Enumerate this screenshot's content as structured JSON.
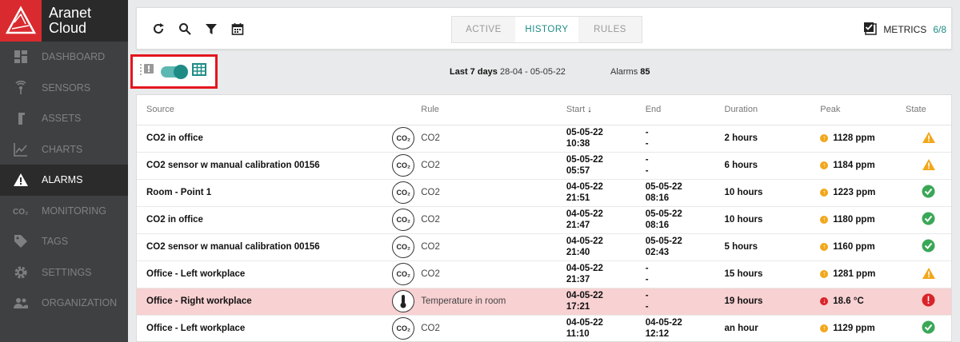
{
  "sidebar": {
    "brand_line1": "Aranet",
    "brand_line2": "Cloud",
    "items": [
      {
        "label": "DASHBOARD",
        "icon": "dashboard-icon",
        "active": false
      },
      {
        "label": "SENSORS",
        "icon": "sensors-icon",
        "active": false
      },
      {
        "label": "ASSETS",
        "icon": "assets-icon",
        "active": false
      },
      {
        "label": "CHARTS",
        "icon": "charts-icon",
        "active": false
      },
      {
        "label": "ALARMS",
        "icon": "alarm-icon",
        "active": true
      },
      {
        "label": "MONITORING",
        "icon": "co2-icon",
        "active": false
      },
      {
        "label": "TAGS",
        "icon": "tag-icon",
        "active": false
      },
      {
        "label": "SETTINGS",
        "icon": "gear-icon",
        "active": false
      },
      {
        "label": "ORGANIZATION",
        "icon": "people-icon",
        "active": false
      }
    ]
  },
  "topbar": {
    "tabs": [
      {
        "label": "ACTIVE",
        "active": false
      },
      {
        "label": "HISTORY",
        "active": true
      },
      {
        "label": "RULES",
        "active": false
      }
    ],
    "metrics_label": "METRICS",
    "metrics_count": "6/8"
  },
  "toolbar": {
    "range_label": "Last 7 days",
    "range_dates": "28-04 - 05-05-22",
    "alarms_label": "Alarms",
    "alarms_count": "85"
  },
  "table": {
    "columns": [
      "Source",
      "Rule",
      "Start",
      "End",
      "Duration",
      "Peak",
      "State"
    ],
    "rows": [
      {
        "source": "CO2 in office",
        "badge": "CO₂",
        "rule": "CO2",
        "start_date": "05-05-22",
        "start_time": "10:38",
        "end_date": "-",
        "end_time": "-",
        "duration": "2 hours",
        "peak": "1128 ppm",
        "peak_dir": "up",
        "state": "warning",
        "alert": false
      },
      {
        "source": "CO2 sensor w manual calibration 00156",
        "badge": "CO₂",
        "rule": "CO2",
        "start_date": "05-05-22",
        "start_time": "05:57",
        "end_date": "-",
        "end_time": "-",
        "duration": "6 hours",
        "peak": "1184 ppm",
        "peak_dir": "up",
        "state": "warning",
        "alert": false
      },
      {
        "source": "Room - Point 1",
        "badge": "CO₂",
        "rule": "CO2",
        "start_date": "04-05-22",
        "start_time": "21:51",
        "end_date": "05-05-22",
        "end_time": "08:16",
        "duration": "10 hours",
        "peak": "1223 ppm",
        "peak_dir": "up",
        "state": "ok",
        "alert": false
      },
      {
        "source": "CO2 in office",
        "badge": "CO₂",
        "rule": "CO2",
        "start_date": "04-05-22",
        "start_time": "21:47",
        "end_date": "05-05-22",
        "end_time": "08:16",
        "duration": "10 hours",
        "peak": "1180 ppm",
        "peak_dir": "up",
        "state": "ok",
        "alert": false
      },
      {
        "source": "CO2 sensor w manual calibration 00156",
        "badge": "CO₂",
        "rule": "CO2",
        "start_date": "04-05-22",
        "start_time": "21:40",
        "end_date": "05-05-22",
        "end_time": "02:43",
        "duration": "5 hours",
        "peak": "1160 ppm",
        "peak_dir": "up",
        "state": "ok",
        "alert": false
      },
      {
        "source": "Office - Left workplace",
        "badge": "CO₂",
        "rule": "CO2",
        "start_date": "04-05-22",
        "start_time": "21:37",
        "end_date": "-",
        "end_time": "-",
        "duration": "15 hours",
        "peak": "1281 ppm",
        "peak_dir": "up",
        "state": "warning",
        "alert": false
      },
      {
        "source": "Office - Right workplace",
        "badge": "thermo",
        "rule": "Temperature in room",
        "start_date": "04-05-22",
        "start_time": "17:21",
        "end_date": "-",
        "end_time": "-",
        "duration": "19 hours",
        "peak": "18.6 °C",
        "peak_dir": "down",
        "state": "error",
        "alert": true
      },
      {
        "source": "Office - Left workplace",
        "badge": "CO₂",
        "rule": "CO2",
        "start_date": "04-05-22",
        "start_time": "11:10",
        "end_date": "04-05-22",
        "end_time": "12:12",
        "duration": "an hour",
        "peak": "1129 ppm",
        "peak_dir": "up",
        "state": "ok",
        "alert": false
      }
    ]
  },
  "colors": {
    "accent": "#1e8c85",
    "warning": "#f2a71b",
    "ok": "#3aa757",
    "error": "#d9232a",
    "highlight": "#e3161f"
  }
}
